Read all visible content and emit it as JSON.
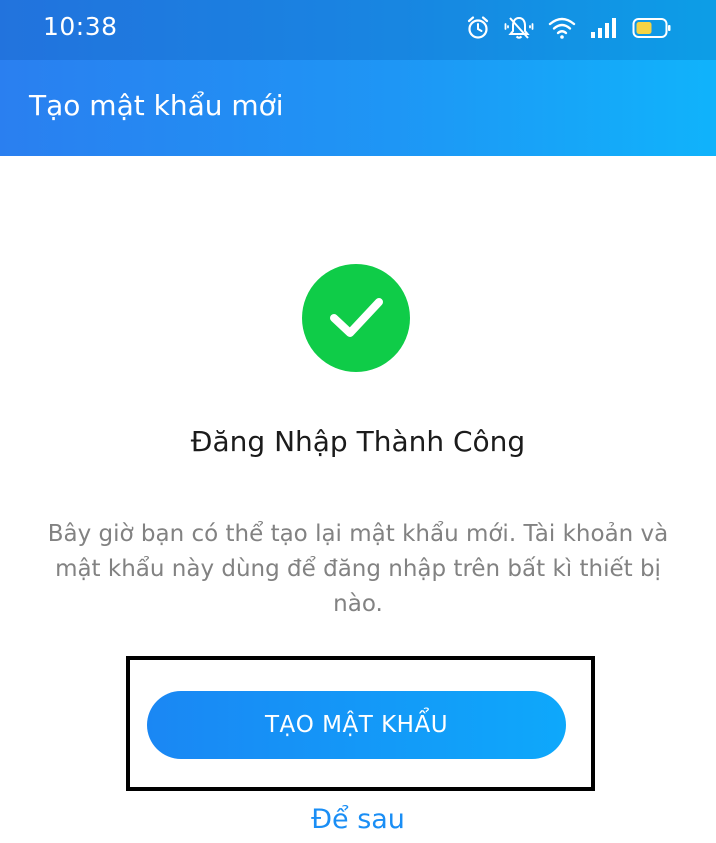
{
  "status_bar": {
    "time": "10:38",
    "icons": [
      "alarm-icon",
      "mute-icon",
      "wifi-icon",
      "signal-icon",
      "battery-icon"
    ]
  },
  "app_bar": {
    "title": "Tạo mật khẩu mới"
  },
  "content": {
    "icon": "check-circle-icon",
    "title": "Đăng Nhập Thành Công",
    "description": "Bây giờ bạn có thể tạo lại mật khẩu mới. Tài khoản và mật khẩu này dùng để đăng nhập trên bất kì thiết bị nào."
  },
  "actions": {
    "primary_label": "TẠO MẬT KHẨU",
    "secondary_label": "Để sau"
  },
  "colors": {
    "header_gradient_start": "#2a7ff0",
    "header_gradient_end": "#10b3fb",
    "success_green": "#0fcc48",
    "link_blue": "#1a8ef5",
    "title_text": "#1b1b1b",
    "description_text": "#828282"
  }
}
